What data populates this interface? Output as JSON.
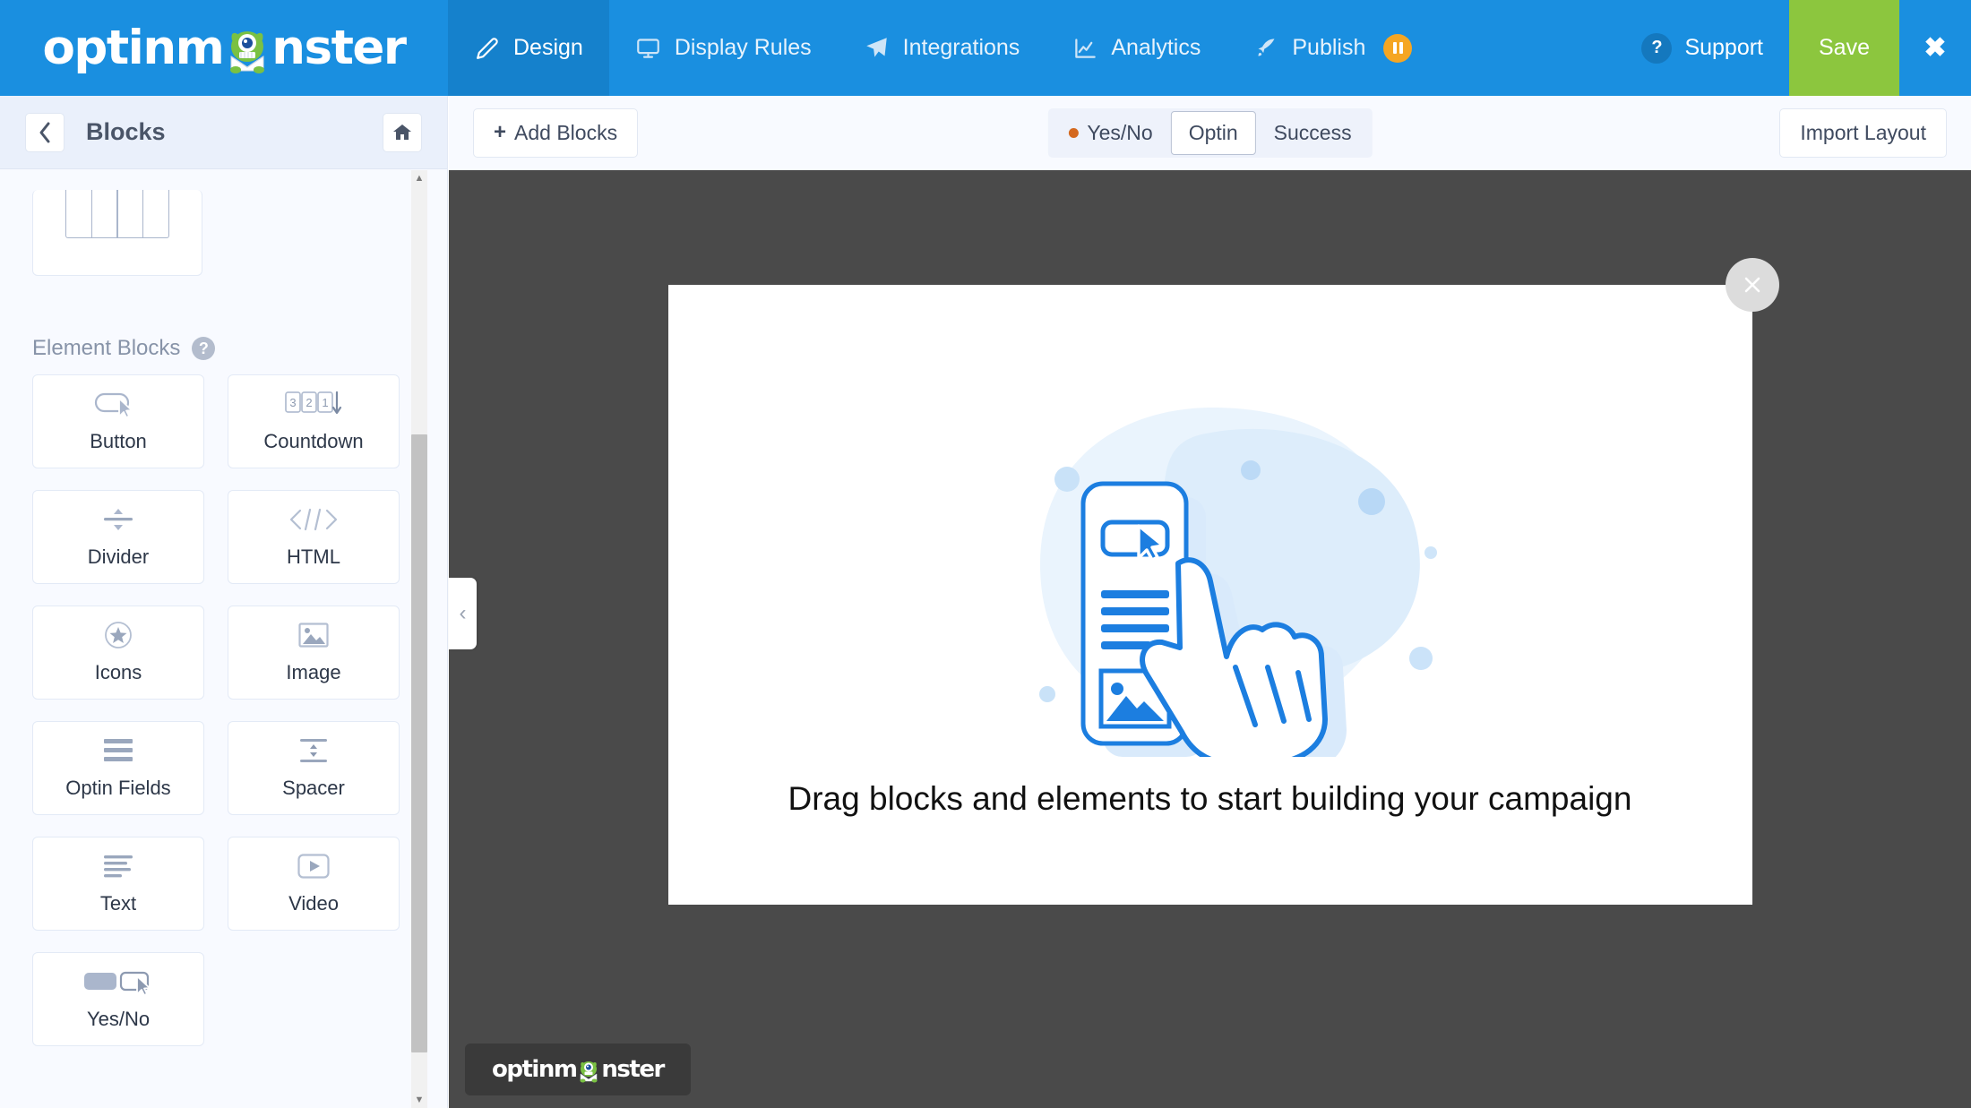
{
  "topnav": {
    "brand": "optinm",
    "brand_tail": "nster",
    "items": [
      {
        "label": "Design",
        "icon": "pencil-icon",
        "active": true
      },
      {
        "label": "Display Rules",
        "icon": "monitor-icon",
        "active": false
      },
      {
        "label": "Integrations",
        "icon": "paper-plane-icon",
        "active": false
      },
      {
        "label": "Analytics",
        "icon": "chart-line-icon",
        "active": false
      },
      {
        "label": "Publish",
        "icon": "rocket-icon",
        "active": false,
        "badge": "paused"
      }
    ],
    "support_label": "Support",
    "help_glyph": "?",
    "save_label": "Save",
    "close_glyph": "✖",
    "accent_blue": "#1a8fe0",
    "active_blue": "#1581cc",
    "save_green": "#8cc63e",
    "badge_orange": "#f5a623"
  },
  "sidebar": {
    "back_glyph": "‹",
    "title": "Blocks",
    "home_icon": "home-icon",
    "section_label": "Element Blocks",
    "section_help": "?",
    "tiles": [
      {
        "label": "Button",
        "icon": "button-cursor-icon"
      },
      {
        "label": "Countdown",
        "icon": "countdown-icon",
        "digits": [
          "3",
          "2",
          "1"
        ]
      },
      {
        "label": "Divider",
        "icon": "divider-icon"
      },
      {
        "label": "HTML",
        "icon": "code-brackets-icon"
      },
      {
        "label": "Icons",
        "icon": "star-circle-icon"
      },
      {
        "label": "Image",
        "icon": "image-icon"
      },
      {
        "label": "Optin Fields",
        "icon": "form-lines-icon"
      },
      {
        "label": "Spacer",
        "icon": "spacer-icon"
      },
      {
        "label": "Text",
        "icon": "text-lines-icon"
      },
      {
        "label": "Video",
        "icon": "play-button-icon"
      },
      {
        "label": "Yes/No",
        "icon": "yesno-buttons-icon"
      }
    ]
  },
  "toolbar": {
    "add_blocks_label": "Add Blocks",
    "add_blocks_plus": "+",
    "tabs": [
      {
        "label": "Yes/No",
        "selected": false,
        "dot": true
      },
      {
        "label": "Optin",
        "selected": true,
        "dot": false
      },
      {
        "label": "Success",
        "selected": false,
        "dot": false
      }
    ],
    "import_layout_label": "Import Layout"
  },
  "canvas": {
    "collapse_glyph": "‹",
    "close_glyph": "✕",
    "headline": "Drag blocks and elements to start building your campaign",
    "illustration": "hand-pointing-at-card-illustration",
    "brand": "optinm",
    "brand_tail": "nster",
    "background": "#4a4a4a",
    "popup_background": "#ffffff"
  }
}
